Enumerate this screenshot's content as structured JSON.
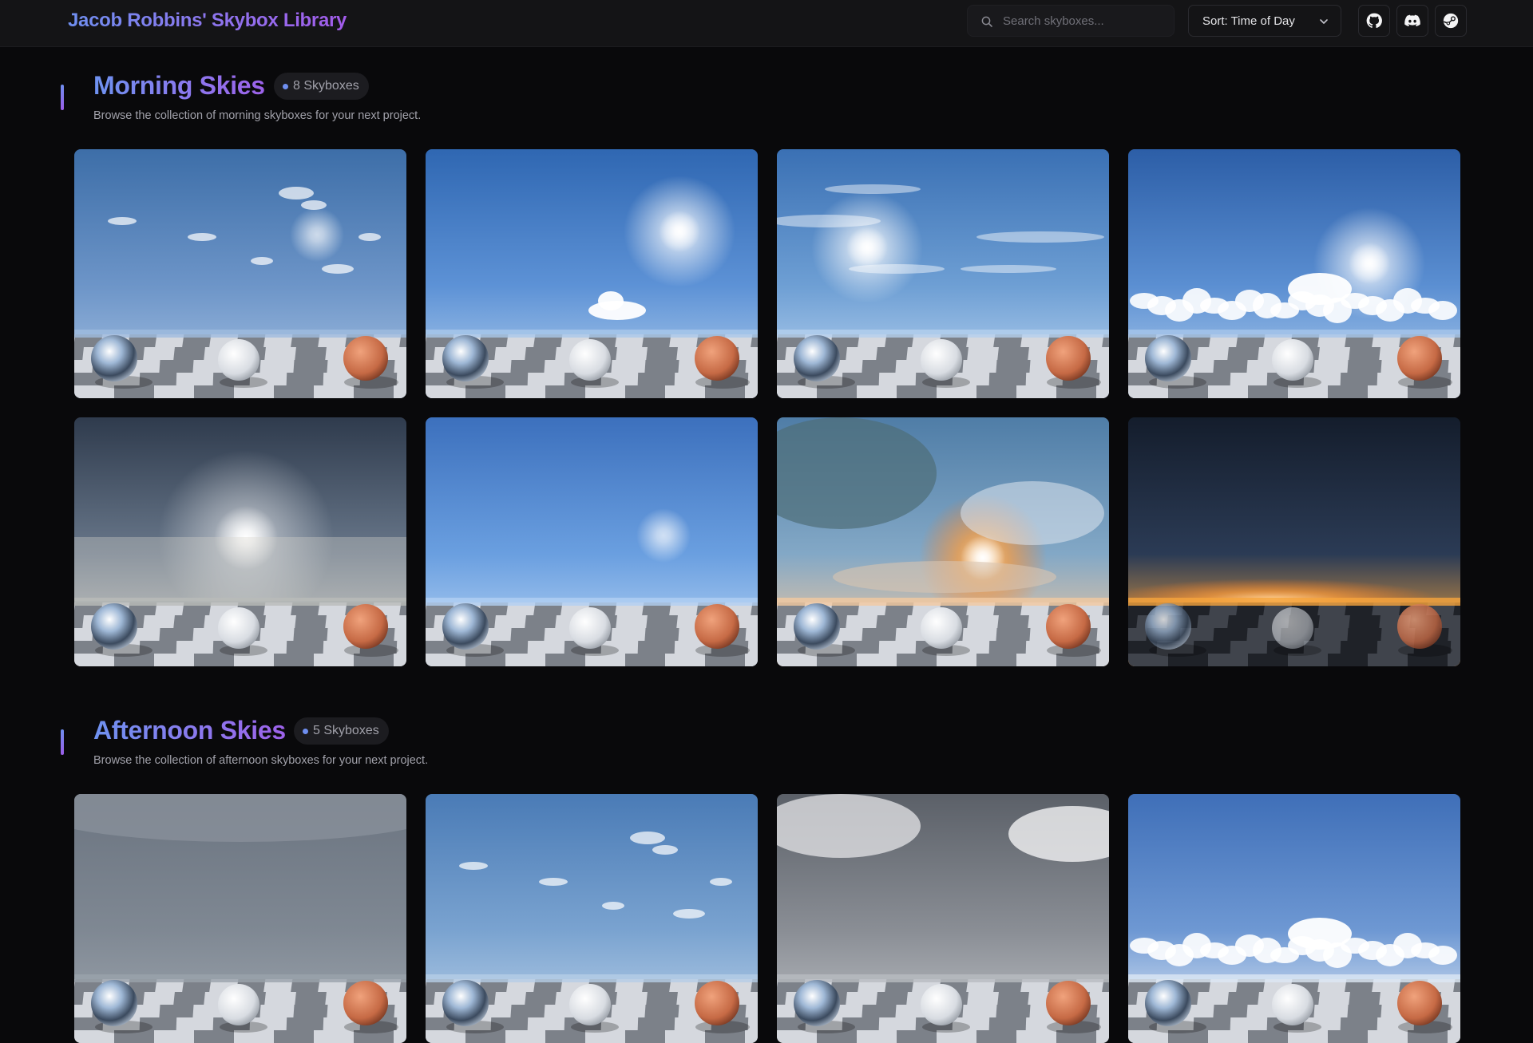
{
  "header": {
    "title": "Jacob Robbins' Skybox Library",
    "search_placeholder": "Search skyboxes...",
    "sort_label": "Sort: Time of Day",
    "icons": [
      "github-icon",
      "discord-icon",
      "steam-icon"
    ]
  },
  "sections": [
    {
      "title": "Morning Skies",
      "count": "8 Skyboxes",
      "description": "Browse the collection of morning skyboxes for your next project.",
      "skyboxes": [
        {
          "sky": [
            "#3d6ea8",
            "#6d95c8",
            "#9fbcdf"
          ],
          "sun": "small",
          "clouds": "scattered"
        },
        {
          "sky": [
            "#2f67b2",
            "#5d92d6",
            "#a9c8ea"
          ],
          "sun": "bright",
          "clouds": "single"
        },
        {
          "sky": [
            "#3a70b4",
            "#6e9fd4",
            "#b4d0ee"
          ],
          "sun": "bright",
          "clouds": "wispy"
        },
        {
          "sky": [
            "#2c5ea7",
            "#5b8fd2",
            "#a6c6ea"
          ],
          "sun": "bright",
          "clouds": "cumulus"
        },
        {
          "sky": [
            "#2f3b4d",
            "#68778a",
            "#b9bbb9"
          ],
          "sun": "hazy",
          "clouds": "haze"
        },
        {
          "sky": [
            "#3c70bd",
            "#6a9fe0",
            "#b2d0f2"
          ],
          "sun": "small",
          "clouds": "none"
        },
        {
          "sky": [
            "#4f7da7",
            "#83a8c6",
            "#f2c9a0"
          ],
          "sun": "sunrise",
          "clouds": "dramatic"
        },
        {
          "sky": [
            "#141d2c",
            "#2b3b55",
            "#f6a53d"
          ],
          "sun": "dawn",
          "clouds": "none"
        }
      ]
    },
    {
      "title": "Afternoon Skies",
      "count": "5 Skyboxes",
      "description": "Browse the collection of afternoon skyboxes for your next project.",
      "skyboxes": [
        {
          "sky": [
            "#6b7480",
            "#7f8893",
            "#9aa2ab"
          ],
          "sun": "none",
          "clouds": "overcast"
        },
        {
          "sky": [
            "#4a7bb6",
            "#7aa3d0",
            "#b5cde6"
          ],
          "sun": "none",
          "clouds": "scattered"
        },
        {
          "sky": [
            "#5b6068",
            "#8a8e95",
            "#b8bbc0"
          ],
          "sun": "none",
          "clouds": "stormy"
        },
        {
          "sky": [
            "#3f6fb8",
            "#6e98d3",
            "#dce7f4"
          ],
          "sun": "none",
          "clouds": "cumulus"
        }
      ]
    }
  ]
}
